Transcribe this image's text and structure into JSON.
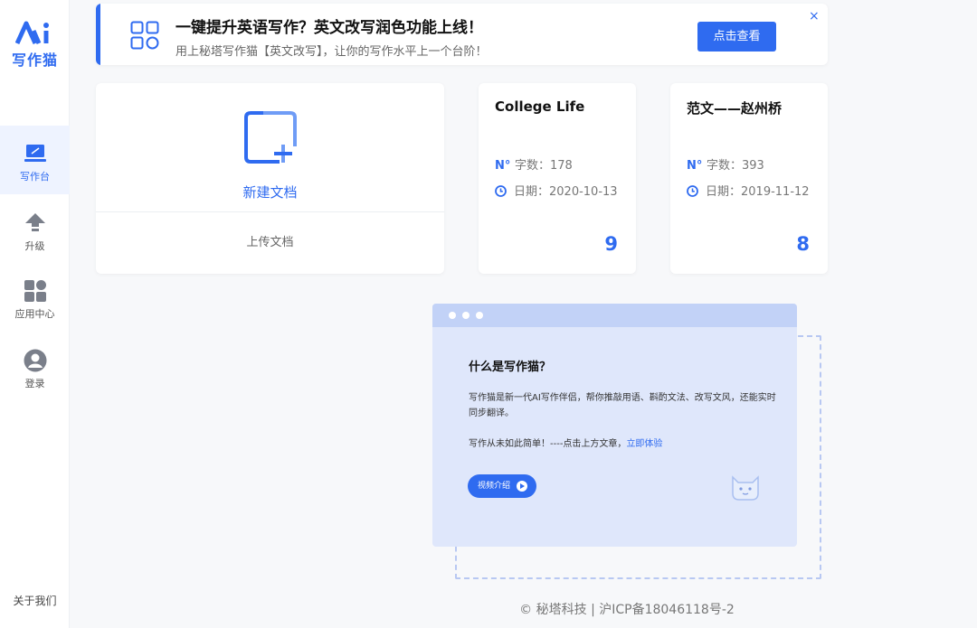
{
  "app": {
    "logo_text": "写作猫"
  },
  "sidebar": {
    "items": [
      {
        "label": "写作台",
        "icon": "laptop-icon",
        "active": true
      },
      {
        "label": "升级",
        "icon": "upgrade-arrow-icon",
        "active": false
      },
      {
        "label": "应用中心",
        "icon": "apps-grid-icon",
        "active": false
      },
      {
        "label": "登录",
        "icon": "user-icon",
        "active": false
      }
    ],
    "about": "关于我们"
  },
  "banner": {
    "title": "一键提升英语写作？英文改写润色功能上线！",
    "subtitle": "用上秘塔写作猫【英文改写】，让你的写作水平上一个台阶！",
    "cta": "点击查看",
    "close": "×"
  },
  "new_doc": {
    "label": "新建文档",
    "upload": "上传文档"
  },
  "docs": [
    {
      "title": "College Life",
      "count_label": "字数：178",
      "date_label": "日期：2020-10-13",
      "number": "9"
    },
    {
      "title": "范文——赵州桥",
      "count_label": "字数：393",
      "date_label": "日期：2019-11-12",
      "number": "8"
    }
  ],
  "meta_icons": {
    "count": "N°",
    "date": "clock-icon"
  },
  "intro": {
    "question": "什么是写作猫？",
    "description": "写作猫是新一代AI写作伴侣，帮你推敲用语、斟酌文法、改写文风，还能实时同步翻译。",
    "cta_prefix": "写作从未如此简单！----点击上方文章，",
    "cta_link": "立即体验",
    "video_button": "视频介绍"
  },
  "footer": "© 秘塔科技 | 沪ICP备18046118号-2",
  "colors": {
    "accent": "#2f6bf0",
    "intro_bg": "#dfe7fb"
  }
}
